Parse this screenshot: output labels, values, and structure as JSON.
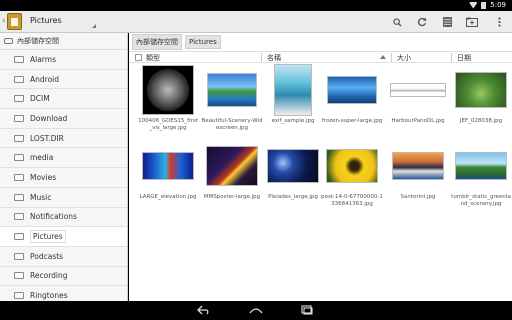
{
  "status_bar": {
    "time": "5:09"
  },
  "action_bar": {
    "title": "Pictures",
    "buttons": [
      "search-icon",
      "refresh-icon",
      "list-view-icon",
      "new-folder-icon",
      "overflow-menu-icon"
    ]
  },
  "sidebar": {
    "root_label": "內部儲存空間",
    "items": [
      {
        "label": "Alarms"
      },
      {
        "label": "Android"
      },
      {
        "label": "DCIM"
      },
      {
        "label": "Download"
      },
      {
        "label": "LOST.DIR"
      },
      {
        "label": "media"
      },
      {
        "label": "Movies"
      },
      {
        "label": "Music"
      },
      {
        "label": "Notifications"
      },
      {
        "label": "Pictures",
        "selected": true
      },
      {
        "label": "Podcasts"
      },
      {
        "label": "Recording"
      },
      {
        "label": "Ringtones"
      }
    ]
  },
  "breadcrumb": [
    "內部儲存空間",
    "Pictures"
  ],
  "columns": {
    "type": "類型",
    "name": "名稱",
    "size": "大小",
    "date": "日期"
  },
  "files": [
    {
      "name": "100406_GOES15_first_vis_large.jpg",
      "thumb": "sun"
    },
    {
      "name": "Beautiful-Scenery-Widescreen.jpg",
      "thumb": "scenery"
    },
    {
      "name": "exif_sample.jpg",
      "thumb": "exif"
    },
    {
      "name": "frozen-super-large.jpg",
      "thumb": "frozen"
    },
    {
      "name": "HarbourPanoDL.jpg",
      "thumb": "harbour"
    },
    {
      "name": "JEF_028038.jpg",
      "thumb": "jef"
    },
    {
      "name": "LARGE_elevation.jpg",
      "thumb": "elev"
    },
    {
      "name": "MMSposter-large.jpg",
      "thumb": "mms"
    },
    {
      "name": "Pleiades_large.jpg",
      "thumb": "pleiades"
    },
    {
      "name": "post-14-0-67700000-1336841363.jpg",
      "thumb": "flower"
    },
    {
      "name": "Santorini.jpg",
      "thumb": "santorini"
    },
    {
      "name": "tumblr_static_greenland_scenery.jpg",
      "thumb": "tumblr"
    }
  ]
}
